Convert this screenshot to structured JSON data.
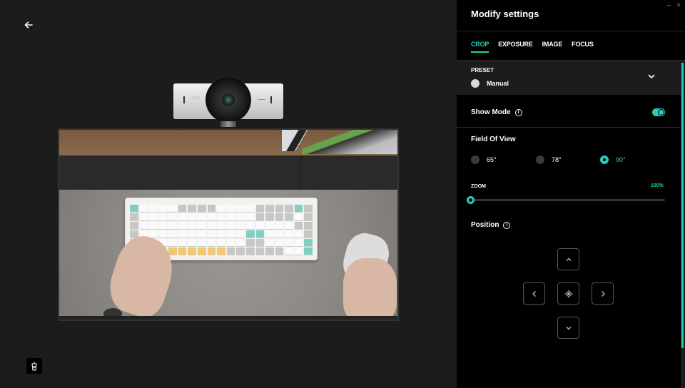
{
  "preview": {
    "back_icon": "arrow-left-icon",
    "camera_logo": "logi",
    "clean_icon": "clean-view-icon"
  },
  "window": {
    "minimize_label": "–",
    "close_label": "×"
  },
  "panel": {
    "title": "Modify settings",
    "tabs": [
      {
        "label": "CROP",
        "active": true
      },
      {
        "label": "EXPOSURE",
        "active": false
      },
      {
        "label": "IMAGE",
        "active": false
      },
      {
        "label": "FOCUS",
        "active": false
      }
    ],
    "preset": {
      "label": "PRESET",
      "value": "Manual"
    },
    "show_mode": {
      "label": "Show Mode",
      "info": "i",
      "enabled": true
    },
    "field_of_view": {
      "title": "Field Of View",
      "options": [
        {
          "label": "65°",
          "selected": false
        },
        {
          "label": "78°",
          "selected": false
        },
        {
          "label": "90°",
          "selected": true
        }
      ]
    },
    "zoom": {
      "label": "ZOOM",
      "value": "100%",
      "slider_fraction": 0.0
    },
    "position": {
      "title": "Position",
      "info": "i",
      "buttons": [
        "up",
        "left",
        "center",
        "right",
        "down"
      ]
    }
  },
  "colors": {
    "accent": "#2ccbb5",
    "panel_bg": "#000000",
    "preview_bg": "#1c1c1c"
  }
}
